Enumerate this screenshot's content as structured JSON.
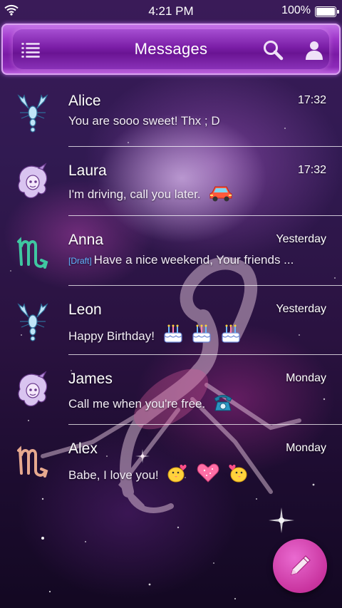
{
  "status_bar": {
    "time": "4:21 PM",
    "battery": "100%"
  },
  "app_bar": {
    "title": "Messages",
    "menu_icon": "menu-list-icon",
    "search_icon": "search-icon",
    "contacts_icon": "contacts-person-icon"
  },
  "colors": {
    "accent": "#8e2bb8",
    "fab": "#c9349f",
    "draft": "#5fb7ff"
  },
  "conversations": [
    {
      "name": "Alice",
      "time": "17:32",
      "draft_label": "",
      "snippet": "You are sooo sweet! Thx ; D",
      "avatar": "scorpion-icon",
      "emoji": []
    },
    {
      "name": "Laura",
      "time": "17:32",
      "draft_label": "",
      "snippet": "I'm driving, call you later.",
      "avatar": "zodiac-girl-icon",
      "emoji": [
        "car-emoji"
      ]
    },
    {
      "name": "Anna",
      "time": "Yesterday",
      "draft_label": "[Draft]",
      "snippet": "Have a nice weekend, Your friends ...",
      "avatar": "scorpio-symbol-icon",
      "emoji": []
    },
    {
      "name": "Leon",
      "time": "Yesterday",
      "draft_label": "",
      "snippet": "Happy Birthday!",
      "avatar": "scorpion-icon",
      "emoji": [
        "cake-emoji",
        "cake-emoji",
        "cake-emoji"
      ]
    },
    {
      "name": "James",
      "time": "Monday",
      "draft_label": "",
      "snippet": "Call me when you're free.",
      "avatar": "zodiac-girl-icon",
      "emoji": [
        "telephone-emoji"
      ]
    },
    {
      "name": "Alex",
      "time": "Monday",
      "draft_label": "",
      "snippet": "Babe, I love you!",
      "avatar": "scorpio-symbol-copper-icon",
      "emoji": [
        "kissing-chick-emoji",
        "heart-emoji",
        "kissing-chick-emoji"
      ]
    }
  ],
  "fab": {
    "icon": "pencil-compose-icon"
  }
}
